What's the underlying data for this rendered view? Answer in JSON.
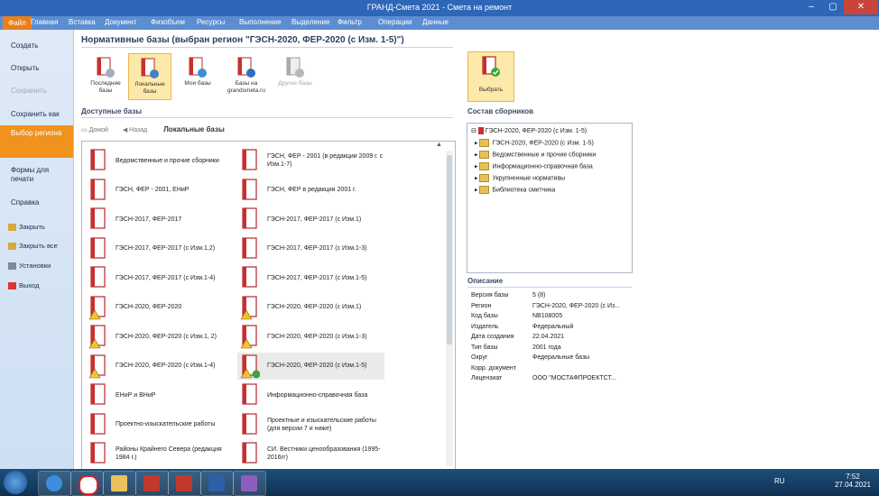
{
  "window": {
    "title": "ГРАНД-Смета 2021 - Смета на ремонт",
    "minimize": "–",
    "maximize": "▢",
    "close": "✕"
  },
  "menu": {
    "file_label": "Файл",
    "items": [
      "Главная",
      "Вставка",
      "Документ",
      "Физобъем",
      "Ресурсы",
      "Выполнение",
      "Выделение",
      "Фильтр",
      "Операции",
      "Данные"
    ]
  },
  "backstage": {
    "items": [
      "Создать",
      "Открыть",
      "Сохранить",
      "Сохранить как",
      "Выбор региона",
      "Формы для печати",
      "Справка"
    ],
    "active_index": 4,
    "small_items": [
      "Закрыть",
      "Закрыть все",
      "Установки",
      "Выход"
    ]
  },
  "heading": "Нормативные базы (выбран регион \"ГЭСН-2020, ФЕР-2020 (с Изм. 1-5)\")",
  "ribbon": {
    "buttons": [
      {
        "label": "Последние базы",
        "icon": "clock-book-icon"
      },
      {
        "label": "Локальные базы",
        "icon": "local-computer-icon"
      },
      {
        "label": "Мои базы",
        "icon": "user-book-icon"
      },
      {
        "label": "Базы на grandsmeta.ru",
        "icon": "web-book-icon"
      },
      {
        "label": "Другие базы",
        "icon": "network-book-icon"
      }
    ],
    "select_label": "Выбрать"
  },
  "available_label": "Доступные базы",
  "nav": {
    "home": "Домой",
    "back": "Назад",
    "location": "Локальные базы"
  },
  "bases": {
    "left": [
      {
        "name": "Ведомственные и прочие сборники",
        "warn": false,
        "check": false
      },
      {
        "name": "ГЭСН, ФЕР - 2001, ЕНиР",
        "warn": false,
        "check": false
      },
      {
        "name": "ГЭСН-2017, ФЕР-2017",
        "warn": false,
        "check": false
      },
      {
        "name": "ГЭСН-2017, ФЕР-2017 (с Изм.1,2)",
        "warn": false,
        "check": false
      },
      {
        "name": "ГЭСН-2017, ФЕР-2017 (с Изм.1-4)",
        "warn": false,
        "check": false
      },
      {
        "name": "ГЭСН-2020, ФЕР-2020",
        "warn": true,
        "check": false
      },
      {
        "name": "ГЭСН-2020, ФЕР-2020 (с Изм.1, 2)",
        "warn": true,
        "check": false
      },
      {
        "name": "ГЭСН-2020, ФЕР-2020 (с Изм.1-4)",
        "warn": true,
        "check": false
      },
      {
        "name": "ЕНиР и ВНиР",
        "warn": false,
        "check": false
      },
      {
        "name": "Проектно-изыскательские работы",
        "warn": false,
        "check": false
      },
      {
        "name": "Районы Крайнего Севера (редакция 1984 г.)",
        "warn": false,
        "check": false
      }
    ],
    "right": [
      {
        "name": "ГЭСН, ФЕР - 2001 (в редакции 2009 г. с Изм.1-7)",
        "warn": false,
        "check": false
      },
      {
        "name": "ГЭСН, ФЕР в редакции 2001 г.",
        "warn": false,
        "check": false
      },
      {
        "name": "ГЭСН-2017, ФЕР-2017 (с Изм.1)",
        "warn": false,
        "check": false
      },
      {
        "name": "ГЭСН-2017, ФЕР-2017 (с Изм.1-3)",
        "warn": false,
        "check": false
      },
      {
        "name": "ГЭСН-2017, ФЕР-2017 (с Изм.1-5)",
        "warn": false,
        "check": false
      },
      {
        "name": "ГЭСН-2020, ФЕР-2020 (с Изм.1)",
        "warn": true,
        "check": false
      },
      {
        "name": "ГЭСН-2020, ФЕР-2020 (с Изм.1-3)",
        "warn": true,
        "check": false
      },
      {
        "name": "ГЭСН-2020, ФЕР-2020 (с Изм.1-5)",
        "warn": true,
        "check": true
      },
      {
        "name": "Информационно-справочная база",
        "warn": false,
        "check": false
      },
      {
        "name": "Проектные и изыскательские работы (для версии 7 и ниже)",
        "warn": false,
        "check": false
      },
      {
        "name": "СИ. Вестники ценообразования (1995-2016гг)",
        "warn": false,
        "check": false
      }
    ],
    "selected": "ГЭСН-2020, ФЕР-2020 (с Изм.1-5)"
  },
  "composition": {
    "label": "Состав сборников",
    "root": "ГЭСН-2020, ФЕР-2020 (с Изм. 1-5)",
    "children": [
      "ГЭСН-2020, ФЕР-2020 (с Изм. 1-5)",
      "Ведомственные и прочие сборники",
      "Информационно-справочная база",
      "Укрупненные нормативы",
      "Библиотека сметчика"
    ]
  },
  "description": {
    "label": "Описание",
    "rows": [
      {
        "key": "Версия базы",
        "value": "5 (8)"
      },
      {
        "key": "Регион",
        "value": "ГЭСН-2020, ФЕР-2020 (с Из..."
      },
      {
        "key": "Код базы",
        "value": "NB108005"
      },
      {
        "key": "Издатель",
        "value": "Федеральный"
      },
      {
        "key": "Дата создания",
        "value": "22.04.2021"
      },
      {
        "key": "Тип базы",
        "value": "2001 года"
      },
      {
        "key": "Округ",
        "value": "Федеральные базы"
      },
      {
        "key": "Корр. документ",
        "value": ""
      },
      {
        "key": "Лицензиат",
        "value": "ООО \"МОСТАФПРОЕКТСТ..."
      }
    ]
  },
  "taskbar": {
    "lang": "RU",
    "time": "7:52",
    "date": "27.04.2021"
  }
}
